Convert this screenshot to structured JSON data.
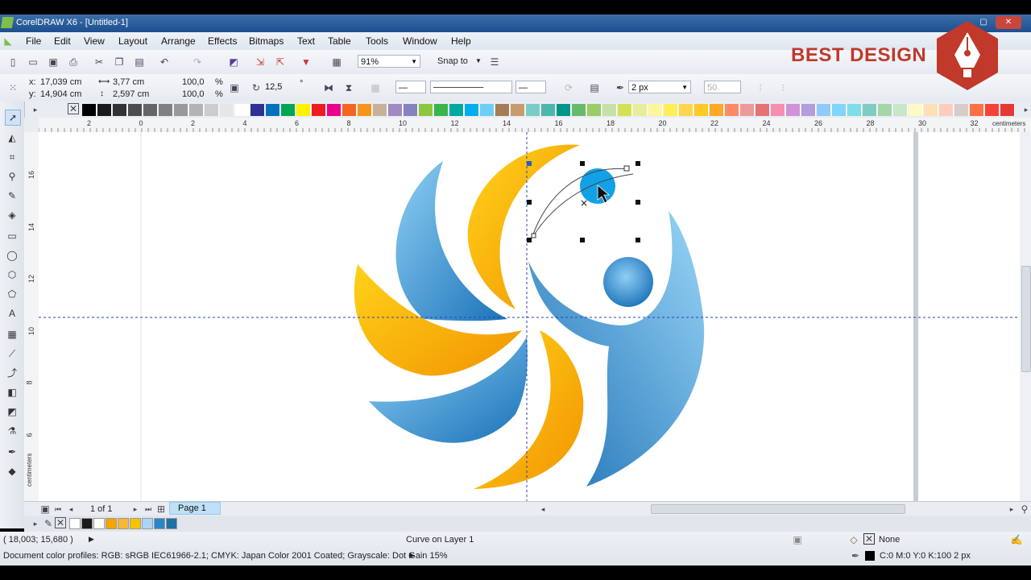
{
  "window": {
    "title": "CorelDRAW X6 - [Untitled-1]"
  },
  "menu": [
    "File",
    "Edit",
    "View",
    "Layout",
    "Arrange",
    "Effects",
    "Bitmaps",
    "Text",
    "Table",
    "Tools",
    "Window",
    "Help"
  ],
  "toolbar": {
    "zoom": "91%",
    "snap_label": "Snap to"
  },
  "property_bar": {
    "x": "17,039 cm",
    "y": "14,904 cm",
    "width": "3,77 cm",
    "height": "2,597 cm",
    "scale_x": "100,0",
    "scale_y": "100,0",
    "percent": "%",
    "rotation": "12,5",
    "degree": "°",
    "outline_width": "2 px",
    "smoothing": "50",
    "x_label": "x:",
    "y_label": "y:"
  },
  "watermark": {
    "text": "BEST DESIGN",
    "color": "#c0392b"
  },
  "ruler_top": [
    "2",
    "0",
    "2",
    "4",
    "6",
    "8",
    "10",
    "12",
    "14",
    "16",
    "18",
    "20",
    "22",
    "24",
    "26",
    "28",
    "30",
    "32"
  ],
  "ruler_unit": "centimeters",
  "ruler_left": [
    "16",
    "14",
    "12",
    "10",
    "8",
    "6"
  ],
  "page_nav": {
    "current": "1 of 1",
    "tab": "Page 1"
  },
  "status": {
    "coords": "( 18,003; 15,680 )",
    "selection": "Curve on Layer 1",
    "fill": "None",
    "outline": "C:0 M:0 Y:0 K:100  2 px",
    "profiles": "Document color profiles: RGB: sRGB IEC61966-2.1; CMYK: Japan Color 2001 Coated; Grayscale: Dot Gain 15%"
  },
  "colors": {
    "blue": "#2b86c8",
    "orange": "#f5a400",
    "selection_blue": "#12a0e6"
  },
  "palette": [
    "#000000",
    "#1a1a1a",
    "#333333",
    "#4d4d4d",
    "#666666",
    "#808080",
    "#999999",
    "#b3b3b3",
    "#cccccc",
    "#e6e6e6",
    "#ffffff",
    "#2e3192",
    "#0072bc",
    "#00a651",
    "#fff200",
    "#ed1c24",
    "#ec008c",
    "#f26522",
    "#f7941d",
    "#c7b299",
    "#9e8bc2",
    "#8781bd",
    "#8dc63f",
    "#39b54a",
    "#00a99d",
    "#00aeef",
    "#6dcff6",
    "#a67c52",
    "#c69c6d",
    "#7accc8",
    "#4db6ac",
    "#009688",
    "#66bb6a",
    "#9ccc65",
    "#c5e1a5",
    "#d4e157",
    "#e6ee9c",
    "#fff59d",
    "#ffee58",
    "#ffd54f",
    "#ffca28",
    "#ffa726",
    "#ff8a65",
    "#ef9a9a",
    "#e57373",
    "#f48fb1",
    "#ce93d8",
    "#b39ddb",
    "#90caf9",
    "#81d4fa",
    "#80deea",
    "#80cbc4",
    "#a5d6a7",
    "#c8e6c9",
    "#fff9c4",
    "#ffe0b2",
    "#ffccbc",
    "#d7ccc8",
    "#ff7043",
    "#f44336",
    "#e53935"
  ],
  "doc_palette": [
    "#ffffff",
    "#1a1a1a",
    "#ffffff",
    "#f5a400",
    "#f7b733",
    "#f5c400",
    "#a9d6f5",
    "#2b86c8",
    "#1f6fa8"
  ]
}
